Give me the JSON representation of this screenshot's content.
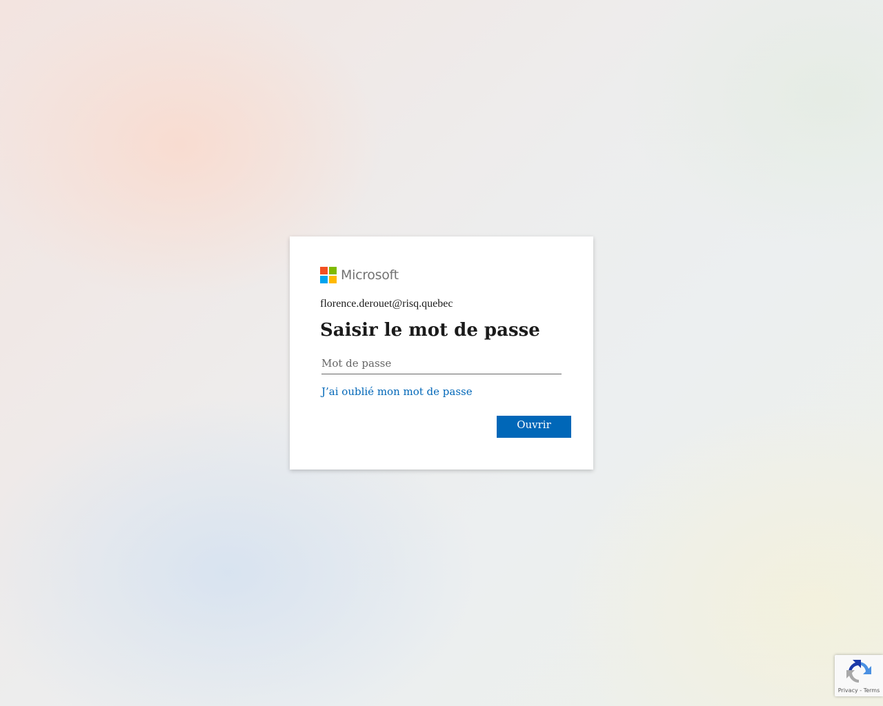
{
  "brand": {
    "name": "Microsoft",
    "colors": [
      "#f25022",
      "#7fba00",
      "#00a4ef",
      "#ffb900"
    ]
  },
  "login": {
    "identity": "florence.derouet@risq.quebec",
    "title": "Saisir le mot de passe",
    "password_placeholder": "Mot de passe",
    "password_value": "",
    "forgot_link": "J’ai oublié mon mot de passe",
    "submit_label": "Ouvrir"
  },
  "recaptcha": {
    "icon": "recaptcha-icon",
    "privacy": "Privacy",
    "separator": "-",
    "terms": "Terms"
  },
  "colors": {
    "accent": "#0067b8",
    "text": "#1b1b1b"
  }
}
